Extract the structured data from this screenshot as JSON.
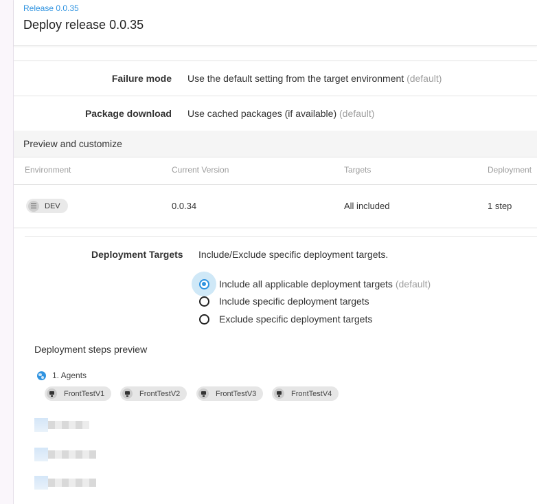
{
  "header": {
    "breadcrumb": "Release 0.0.35",
    "title": "Deploy release 0.0.35"
  },
  "settings": [
    {
      "label": "Failure mode",
      "value": "Use the default setting from the target environment",
      "suffix": "(default)"
    },
    {
      "label": "Package download",
      "value": "Use cached packages (if available)",
      "suffix": "(default)"
    }
  ],
  "preview": {
    "section_title": "Preview and customize",
    "columns": [
      "Environment",
      "Current Version",
      "Targets",
      "Deployment"
    ],
    "rows": [
      {
        "environment": "DEV",
        "current_version": "0.0.34",
        "targets": "All included",
        "deployment": "1 step"
      }
    ]
  },
  "deployment_targets": {
    "label": "Deployment Targets",
    "description": "Include/Exclude specific deployment targets.",
    "options": [
      {
        "label": "Include all applicable deployment targets",
        "suffix": "(default)",
        "selected": true
      },
      {
        "label": "Include specific deployment targets",
        "suffix": "",
        "selected": false
      },
      {
        "label": "Exclude specific deployment targets",
        "suffix": "",
        "selected": false
      }
    ]
  },
  "steps_preview": {
    "title": "Deployment steps preview",
    "steps": [
      {
        "label": "1. Agents",
        "icon": "globe-icon",
        "targets": [
          "FrontTestV1",
          "FrontTestV2",
          "FrontTestV3",
          "FrontTestV4"
        ]
      }
    ]
  },
  "colors": {
    "accent": "#2f93e0",
    "selected_halo": "#cfe8f7",
    "section_bg": "#f5f5f5",
    "chip_bg": "#e6e6e6"
  }
}
